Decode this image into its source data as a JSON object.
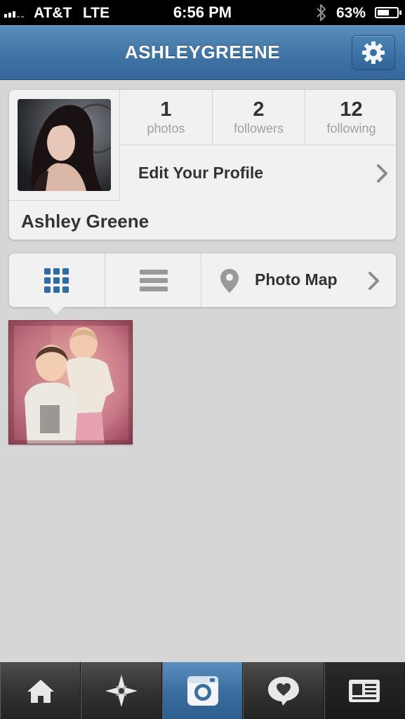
{
  "status_bar": {
    "carrier": "AT&T",
    "network": "LTE",
    "time": "6:56 PM",
    "battery": "63%",
    "battery_level": 0.63
  },
  "nav": {
    "title": "ASHLEYGREENE",
    "settings_icon": "gear-icon"
  },
  "profile": {
    "stats": [
      {
        "value": "1",
        "label": "photos"
      },
      {
        "value": "2",
        "label": "followers"
      },
      {
        "value": "12",
        "label": "following"
      }
    ],
    "edit_label": "Edit Your Profile",
    "name": "Ashley Greene"
  },
  "view_tabs": {
    "grid_icon": "grid-icon",
    "list_icon": "list-icon",
    "map_icon": "map-pin-icon",
    "map_label": "Photo Map"
  },
  "photos": [
    {
      "alt": "two children photo"
    }
  ],
  "tab_bar": {
    "items": [
      {
        "icon": "home-icon"
      },
      {
        "icon": "explore-icon"
      },
      {
        "icon": "camera-icon"
      },
      {
        "icon": "news-icon"
      },
      {
        "icon": "profile-icon"
      }
    ],
    "active_index": 2
  },
  "colors": {
    "nav_blue": "#3f74a4",
    "background": "#d6d6d6",
    "card": "#f1f1f1",
    "tab_active": "#3b6f9f"
  }
}
